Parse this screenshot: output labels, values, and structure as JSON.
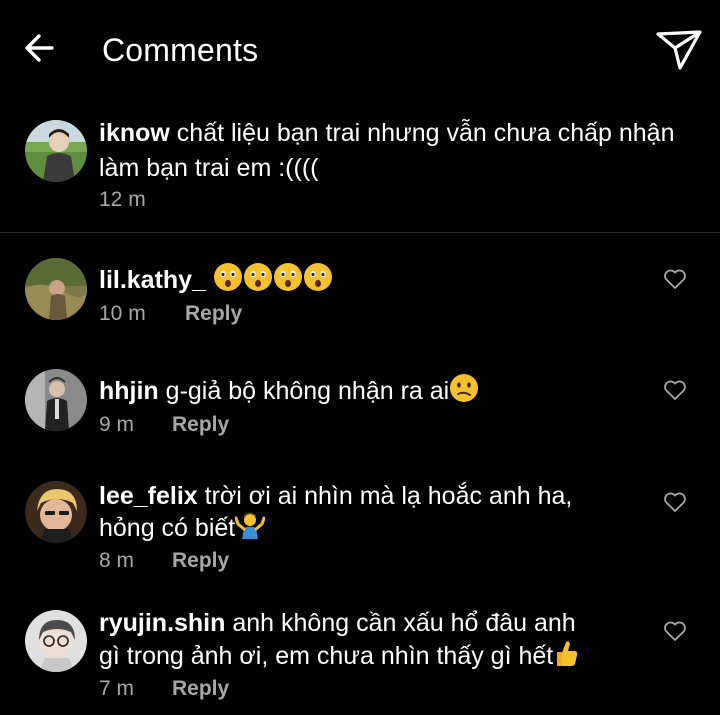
{
  "header": {
    "title": "Comments"
  },
  "caption": {
    "username": "iknow",
    "text": " chất liệu bạn trai nhưng vẫn chưa chấp nhận",
    "text_line2": "làm bạn trai em :((((",
    "time": "12 m"
  },
  "comments": [
    {
      "username": "lil.kathy_",
      "text": " ",
      "time": "10 m",
      "reply": "Reply"
    },
    {
      "username": "hhjin",
      "text": " g-giả bộ không nhận ra ai",
      "time": "9 m",
      "reply": "Reply"
    },
    {
      "username": "lee_felix",
      "text": " trời ơi ai nhìn mà lạ hoắc anh ha,",
      "text_line2": "hỏng có biết",
      "time": "8 m",
      "reply": "Reply"
    },
    {
      "username": "ryujin.shin",
      "text": " anh không cần xấu hổ đâu anh",
      "text_line2": "gì trong ảnh ơi, em chưa nhìn thấy gì hết",
      "time": "7 m",
      "reply": "Reply"
    }
  ],
  "icons": {
    "back": "back-arrow-icon",
    "send": "send-icon",
    "like": "heart-outline-icon"
  },
  "colors": {
    "background": "#000000",
    "text": "#ffffff",
    "secondary": "#a8a8a8"
  }
}
